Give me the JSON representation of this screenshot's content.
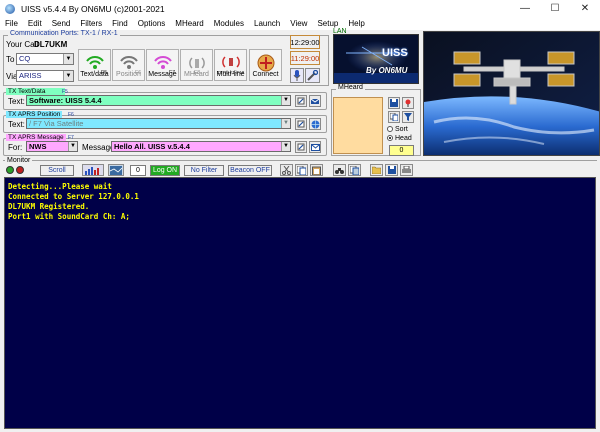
{
  "window": {
    "title": "UISS v5.4.4 By ON6MU (c)2001-2021",
    "controls": [
      "—",
      "☐",
      "✕"
    ]
  },
  "menu": [
    "File",
    "Edit",
    "Send",
    "Filters",
    "Find",
    "Options",
    "MHeard",
    "Modules",
    "Launch",
    "View",
    "Setup",
    "Help"
  ],
  "comm_ports": {
    "group_title": "Communication Ports: TX-1 / RX-1",
    "your_call_label": "Your Call",
    "your_call": "DL7UKM",
    "to_label": "To",
    "to_value": "CQ",
    "via_label": "Via",
    "via_value": "ARISS"
  },
  "toolbar": {
    "buttons": [
      {
        "label": "Text/data",
        "key": "F5"
      },
      {
        "label": "Position",
        "key": "F6"
      },
      {
        "label": "Message",
        "key": "F7"
      },
      {
        "label": "MHeard",
        "key": "F8"
      },
      {
        "label": "Multi-line",
        "key": "CTRL F1-F12"
      },
      {
        "label": "Connect",
        "key": ""
      }
    ]
  },
  "clocks": {
    "utc": "12:29:00",
    "local": "11:29:00"
  },
  "lan": {
    "label": "LAN",
    "banner_brand": "UISS",
    "banner_by": "By ON6MU"
  },
  "tx_text": {
    "group_title": "TX Text/Data",
    "key": "F5",
    "field_label": "Text:",
    "value": "Software: UISS 5.4.4",
    "color": "#7fffc0"
  },
  "tx_position": {
    "group_title": "TX APRS Position",
    "key": "F6",
    "field_label": "Text:",
    "value": "/ F7 Via Satellite",
    "color": "#7fe8ff"
  },
  "tx_message": {
    "group_title": "TX APRS Message",
    "key": "F7",
    "for_label": "For:",
    "for_value": "NWS",
    "message_label": "Message:",
    "message_value": "Hello All. UISS v.5.4.4",
    "color": "#ffa8ff"
  },
  "mheard": {
    "group_title": "MHeard",
    "sort_label": "Sort",
    "head_label": "Head",
    "count": "0"
  },
  "monitor": {
    "group_title": "Monitor",
    "scroll_label": "Scroll",
    "counter": "0",
    "log_label": "Log ON",
    "filter_label": "No Filter",
    "beacon_label": "Beacon OFF"
  },
  "terminal_lines": [
    "Detecting...Please wait",
    "Connected to Server 127.0.0.1",
    "DL7UKM Registered.",
    "Port1 with SoundCard Ch: A;"
  ]
}
